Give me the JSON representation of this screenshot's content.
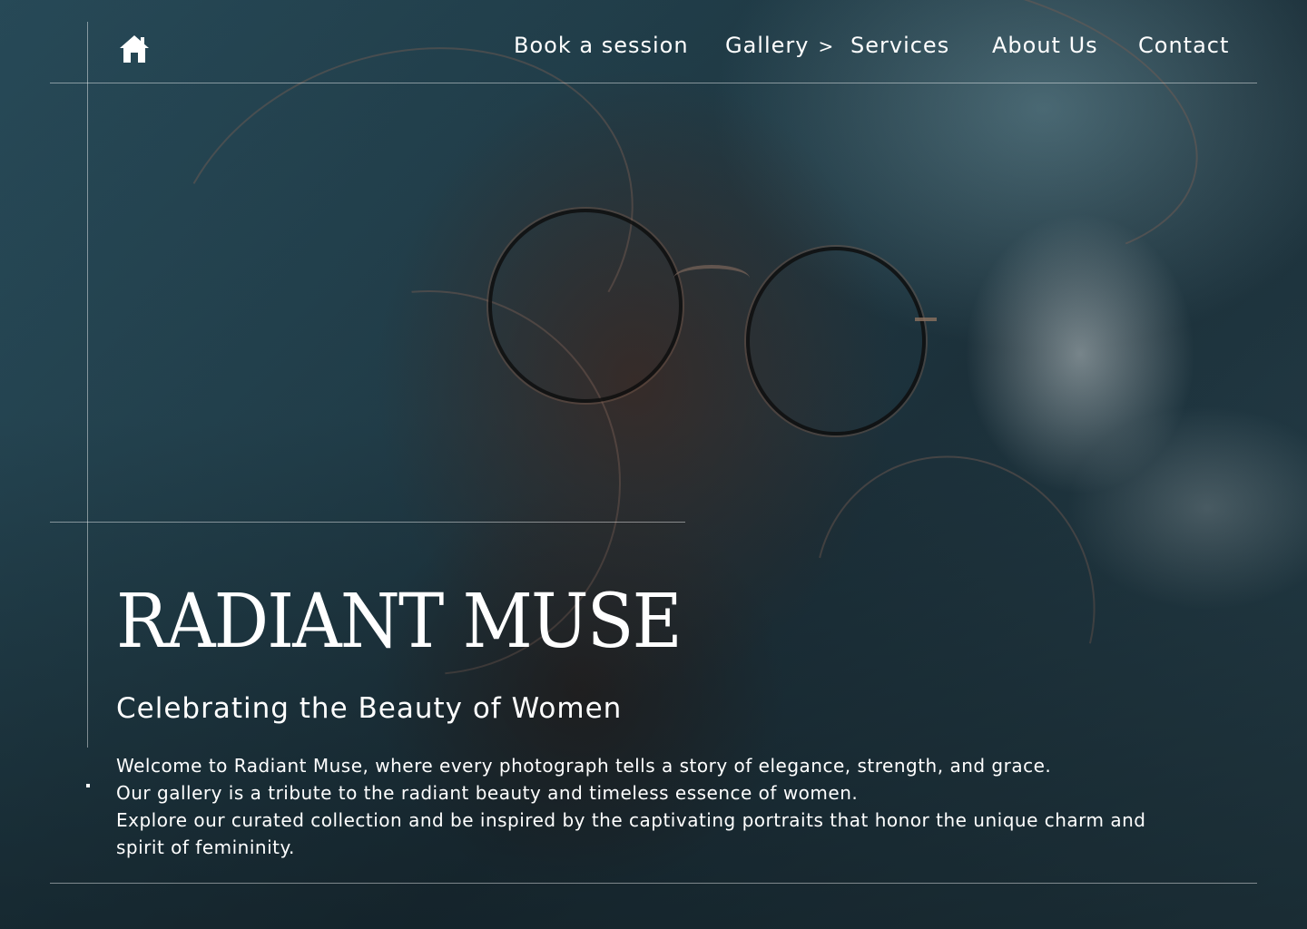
{
  "nav": {
    "home_icon": "home-icon",
    "items": [
      {
        "label": "Book a session"
      },
      {
        "label": "Gallery",
        "chevron": ">"
      },
      {
        "label": "Services"
      },
      {
        "label": "About Us"
      },
      {
        "label": "Contact"
      }
    ]
  },
  "hero": {
    "title": "RADIANT MUSE",
    "subtitle": "Celebrating the Beauty of Women",
    "intro": [
      "Welcome to Radiant Muse, where every photograph tells a story of elegance, strength, and grace.",
      "Our gallery is a tribute to the radiant beauty and timeless essence of women.",
      "Explore our curated collection and be inspired by the captivating portraits that honor the unique charm and spirit of femininity."
    ]
  },
  "colors": {
    "text": "#ffffff",
    "background": "#2a4f5e"
  }
}
